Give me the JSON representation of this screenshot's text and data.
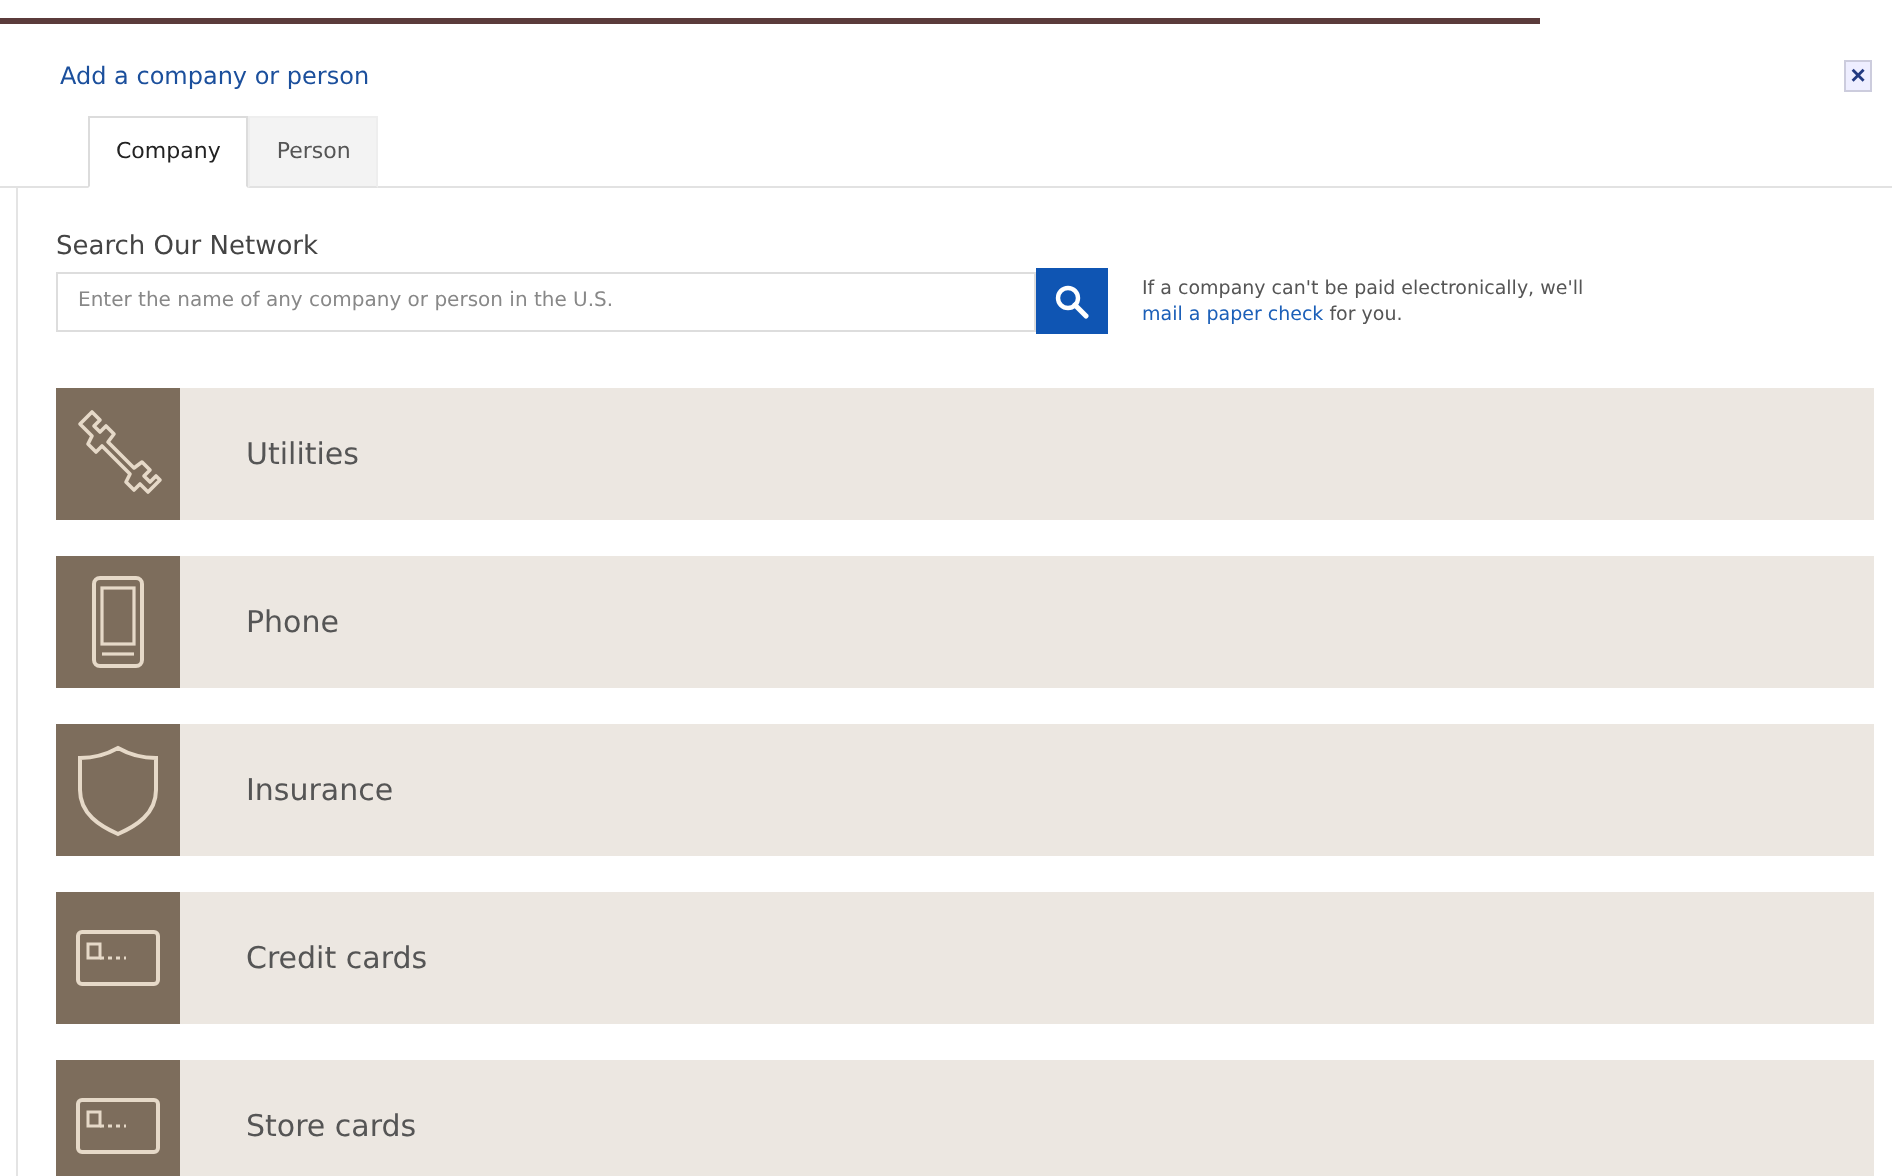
{
  "dialog": {
    "title": "Add a company or person",
    "close": "×"
  },
  "tabs": [
    {
      "label": "Company",
      "selected": true
    },
    {
      "label": "Person",
      "selected": false
    }
  ],
  "search": {
    "label": "Search Our Network",
    "placeholder": "Enter the name of any company or person in the U.S."
  },
  "note": {
    "before": "If a company can't be paid electronically, we'll ",
    "link": "mail a paper check",
    "after": " for you."
  },
  "categories": [
    {
      "label": "Utilities"
    },
    {
      "label": "Phone"
    },
    {
      "label": "Insurance"
    },
    {
      "label": "Credit cards"
    },
    {
      "label": "Store cards"
    }
  ]
}
